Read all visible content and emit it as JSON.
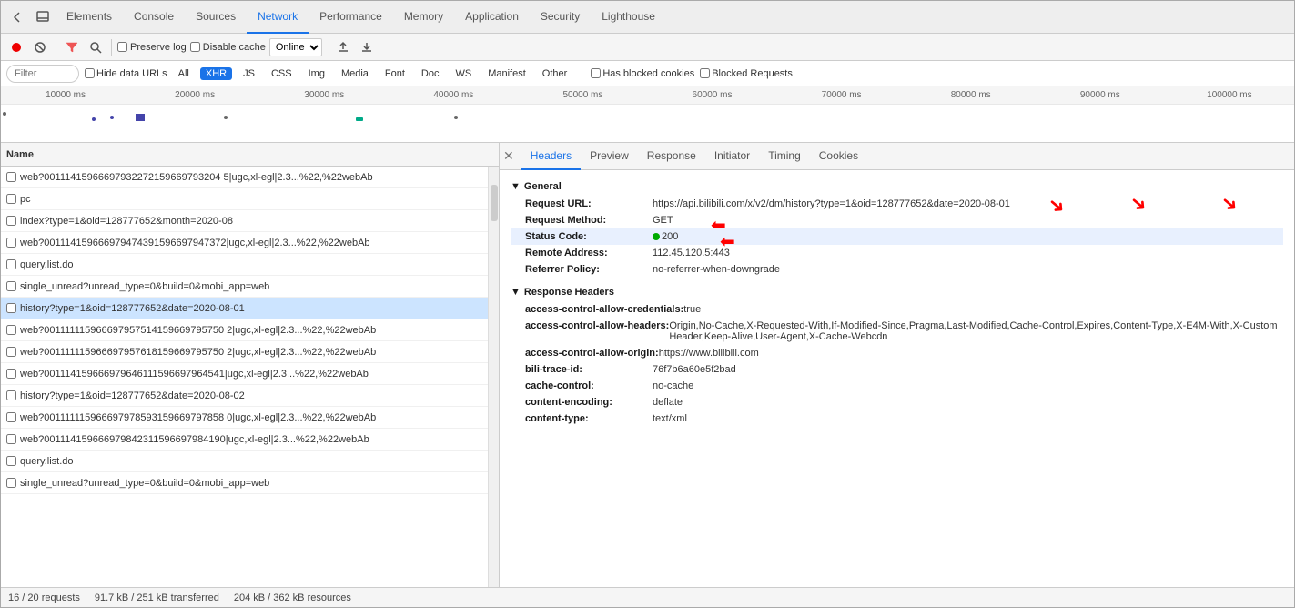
{
  "tabs": {
    "items": [
      {
        "label": "Elements",
        "active": false
      },
      {
        "label": "Console",
        "active": false
      },
      {
        "label": "Sources",
        "active": false
      },
      {
        "label": "Network",
        "active": true
      },
      {
        "label": "Performance",
        "active": false
      },
      {
        "label": "Memory",
        "active": false
      },
      {
        "label": "Application",
        "active": false
      },
      {
        "label": "Security",
        "active": false
      },
      {
        "label": "Lighthouse",
        "active": false
      }
    ]
  },
  "toolbar": {
    "preserve_log": "Preserve log",
    "disable_cache": "Disable cache",
    "online_label": "Online"
  },
  "filter": {
    "placeholder": "Filter",
    "hide_data_urls": "Hide data URLs",
    "all": "All",
    "types": [
      "XHR",
      "JS",
      "CSS",
      "Img",
      "Media",
      "Font",
      "Doc",
      "WS",
      "Manifest",
      "Other"
    ],
    "active_type": "XHR",
    "has_blocked": "Has blocked cookies",
    "blocked_requests": "Blocked Requests"
  },
  "timeline": {
    "labels": [
      "10000 ms",
      "20000 ms",
      "30000 ms",
      "40000 ms",
      "50000 ms",
      "60000 ms",
      "70000 ms",
      "80000 ms",
      "90000 ms",
      "100000 ms"
    ]
  },
  "requests": {
    "header": "Name",
    "items": [
      {
        "name": "web?00111415966697932272159669793204 5|ugc,xl-egl|2.3...%22,%22webAb",
        "selected": false
      },
      {
        "name": "pc",
        "selected": false
      },
      {
        "name": "index?type=1&oid=128777652&month=2020-08",
        "selected": false
      },
      {
        "name": "web?001114159666979474391596697947372|ugc,xl-egl|2.3...%22,%22webAb",
        "selected": false
      },
      {
        "name": "query.list.do",
        "selected": false
      },
      {
        "name": "single_unread?unread_type=0&build=0&mobi_app=web",
        "selected": false
      },
      {
        "name": "history?type=1&oid=128777652&date=2020-08-01",
        "selected": true
      },
      {
        "name": "web?001111115966697957514159669795750 2|ugc,xl-egl|2.3...%22,%22webAb",
        "selected": false
      },
      {
        "name": "web?001111115966697957618159669795750 2|ugc,xl-egl|2.3...%22,%22webAb",
        "selected": false
      },
      {
        "name": "web?001114159666979646111596697964541|ugc,xl-egl|2.3...%22,%22webAb",
        "selected": false
      },
      {
        "name": "history?type=1&oid=128777652&date=2020-08-02",
        "selected": false
      },
      {
        "name": "web?001111115966697978593159669797858 0|ugc,xl-egl|2.3...%22,%22webAb",
        "selected": false
      },
      {
        "name": "web?001114159666979842311596697984190|ugc,xl-egl|2.3...%22,%22webAb",
        "selected": false
      },
      {
        "name": "query.list.do",
        "selected": false
      },
      {
        "name": "single_unread?unread_type=0&build=0&mobi_app=web",
        "selected": false
      }
    ]
  },
  "details": {
    "tabs": [
      "Headers",
      "Preview",
      "Response",
      "Initiator",
      "Timing",
      "Cookies"
    ],
    "active_tab": "Headers",
    "general": {
      "section_label": "General",
      "request_url_key": "Request URL:",
      "request_url_val": "https://api.bilibili.com/x/v2/dm/history?type=1&oid=128777652&date=2020-08-01",
      "method_key": "Request Method:",
      "method_val": "GET",
      "status_key": "Status Code:",
      "status_val": "200",
      "remote_key": "Remote Address:",
      "remote_val": "112.45.120.5:443",
      "referrer_key": "Referrer Policy:",
      "referrer_val": "no-referrer-when-downgrade"
    },
    "response_headers": {
      "section_label": "Response Headers",
      "items": [
        {
          "key": "access-control-allow-credentials:",
          "val": "true"
        },
        {
          "key": "access-control-allow-headers:",
          "val": "Origin,No-Cache,X-Requested-With,If-Modified-Since,Pragma,Last-Modified,Cache-Control,Expires,Content-Type,X-E4M-With,X-CustomHeader,Keep-Alive,User-Agent,X-Cache-Webcdn"
        },
        {
          "key": "access-control-allow-origin:",
          "val": "https://www.bilibili.com"
        },
        {
          "key": "bili-trace-id:",
          "val": "76f7b6a60e5f2bad"
        },
        {
          "key": "cache-control:",
          "val": "no-cache"
        },
        {
          "key": "content-encoding:",
          "val": "deflate"
        },
        {
          "key": "content-type:",
          "val": "text/xml"
        }
      ]
    }
  },
  "status_bar": {
    "requests": "16 / 20 requests",
    "transferred": "91.7 kB / 251 kB transferred",
    "resources": "204 kB / 362 kB resources"
  },
  "icons": {
    "back": "←",
    "circle": "⊙",
    "stop": "⊗",
    "filter": "▽",
    "search": "🔍",
    "record_off": "⏺",
    "upload": "⬆",
    "download": "⬇",
    "triangle_down": "▼",
    "close": "✕"
  }
}
